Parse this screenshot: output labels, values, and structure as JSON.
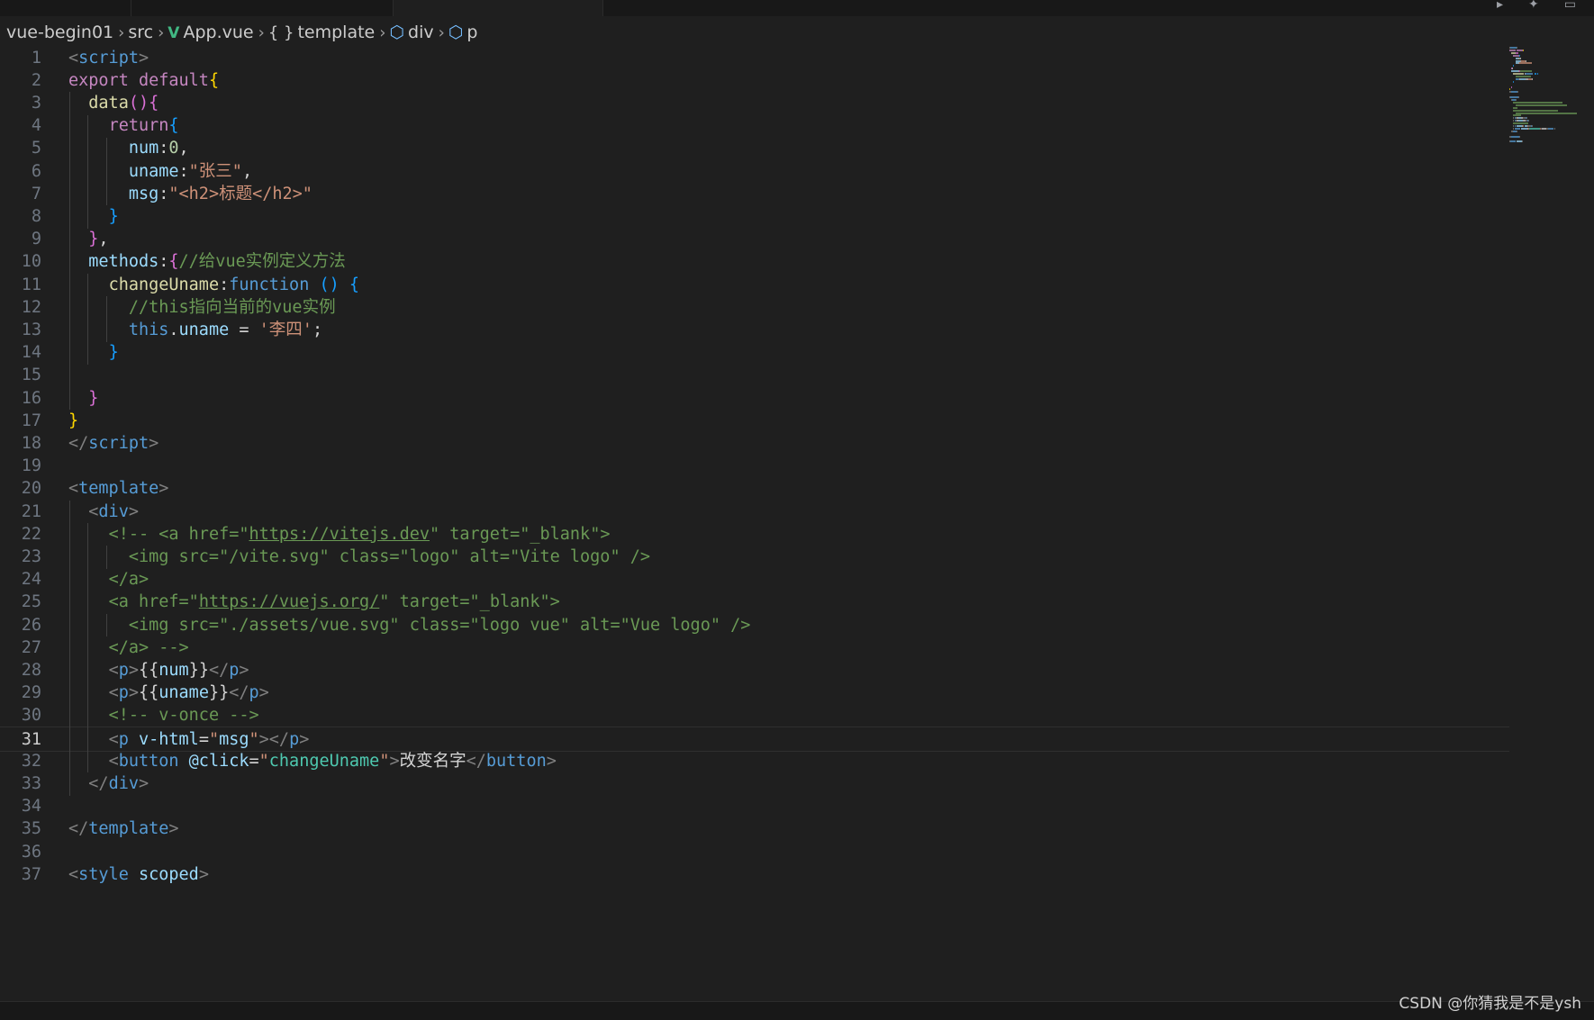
{
  "breadcrumb": {
    "items": [
      {
        "label": "vue-begin01",
        "icon": null
      },
      {
        "label": "src",
        "icon": null
      },
      {
        "label": "App.vue",
        "icon": "vue-icon",
        "glyph": "V"
      },
      {
        "label": "template",
        "icon": "braces-icon",
        "glyph": "{ }"
      },
      {
        "label": "div",
        "icon": "cube-icon",
        "glyph": "⬡"
      },
      {
        "label": "p",
        "icon": "cube-icon",
        "glyph": "⬡"
      }
    ],
    "separator": "›"
  },
  "editor": {
    "current_line": 31,
    "lines": [
      {
        "n": "1",
        "tokens": [
          [
            "t-p",
            "<"
          ],
          [
            "t-tag",
            "script"
          ],
          [
            "t-p",
            ">"
          ]
        ]
      },
      {
        "n": "2",
        "tokens": [
          [
            "t-ctl",
            "export"
          ],
          [
            "t-txt",
            " "
          ],
          [
            "t-ctl",
            "default"
          ],
          [
            "t-b1",
            "{"
          ]
        ]
      },
      {
        "n": "3",
        "tokens": [
          [
            "t-txt",
            "  "
          ],
          [
            "t-fn",
            "data"
          ],
          [
            "t-b2",
            "(){"
          ]
        ]
      },
      {
        "n": "4",
        "tokens": [
          [
            "t-txt",
            "    "
          ],
          [
            "t-ctl",
            "return"
          ],
          [
            "t-b3",
            "{"
          ]
        ]
      },
      {
        "n": "5",
        "tokens": [
          [
            "t-txt",
            "      "
          ],
          [
            "t-prop",
            "num"
          ],
          [
            "t-txt",
            ":"
          ],
          [
            "t-num",
            "0"
          ],
          [
            "t-txt",
            ","
          ]
        ]
      },
      {
        "n": "6",
        "tokens": [
          [
            "t-txt",
            "      "
          ],
          [
            "t-prop",
            "uname"
          ],
          [
            "t-txt",
            ":"
          ],
          [
            "t-str",
            "\"张三\""
          ],
          [
            "t-txt",
            ","
          ]
        ]
      },
      {
        "n": "7",
        "tokens": [
          [
            "t-txt",
            "      "
          ],
          [
            "t-prop",
            "msg"
          ],
          [
            "t-txt",
            ":"
          ],
          [
            "t-str",
            "\"<h2>标题</h2>\""
          ]
        ]
      },
      {
        "n": "8",
        "tokens": [
          [
            "t-txt",
            "    "
          ],
          [
            "t-b3",
            "}"
          ]
        ]
      },
      {
        "n": "9",
        "tokens": [
          [
            "t-txt",
            "  "
          ],
          [
            "t-b2",
            "}"
          ],
          [
            "t-txt",
            ","
          ]
        ]
      },
      {
        "n": "10",
        "tokens": [
          [
            "t-txt",
            "  "
          ],
          [
            "t-prop",
            "methods"
          ],
          [
            "t-txt",
            ":"
          ],
          [
            "t-b2",
            "{"
          ],
          [
            "t-cm",
            "//给vue实例定义方法"
          ]
        ]
      },
      {
        "n": "11",
        "tokens": [
          [
            "t-txt",
            "    "
          ],
          [
            "t-fn",
            "changeUname"
          ],
          [
            "t-txt",
            ":"
          ],
          [
            "t-kw",
            "function"
          ],
          [
            "t-txt",
            " "
          ],
          [
            "t-b3",
            "()"
          ],
          [
            "t-txt",
            " "
          ],
          [
            "t-b3",
            "{"
          ]
        ]
      },
      {
        "n": "12",
        "tokens": [
          [
            "t-txt",
            "      "
          ],
          [
            "t-cm",
            "//this指向当前的vue实例"
          ]
        ]
      },
      {
        "n": "13",
        "tokens": [
          [
            "t-txt",
            "      "
          ],
          [
            "t-kw",
            "this"
          ],
          [
            "t-txt",
            "."
          ],
          [
            "t-prop",
            "uname"
          ],
          [
            "t-txt",
            " = "
          ],
          [
            "t-str",
            "'李四'"
          ],
          [
            "t-txt",
            ";"
          ]
        ]
      },
      {
        "n": "14",
        "tokens": [
          [
            "t-txt",
            "    "
          ],
          [
            "t-b3",
            "}"
          ]
        ]
      },
      {
        "n": "15",
        "tokens": []
      },
      {
        "n": "16",
        "tokens": [
          [
            "t-txt",
            "  "
          ],
          [
            "t-b2",
            "}"
          ]
        ]
      },
      {
        "n": "17",
        "tokens": [
          [
            "t-b1",
            "}"
          ]
        ]
      },
      {
        "n": "18",
        "tokens": [
          [
            "t-p",
            "</"
          ],
          [
            "t-tag",
            "script"
          ],
          [
            "t-p",
            ">"
          ]
        ]
      },
      {
        "n": "19",
        "tokens": []
      },
      {
        "n": "20",
        "tokens": [
          [
            "t-p",
            "<"
          ],
          [
            "t-tag",
            "template"
          ],
          [
            "t-p",
            ">"
          ]
        ]
      },
      {
        "n": "21",
        "tokens": [
          [
            "t-txt",
            "  "
          ],
          [
            "t-p",
            "<"
          ],
          [
            "t-tag",
            "div"
          ],
          [
            "t-p",
            ">"
          ]
        ]
      },
      {
        "n": "22",
        "tokens": [
          [
            "t-txt",
            "    "
          ],
          [
            "t-cm",
            "<!-- <a href=\""
          ],
          [
            "t-cm t-url",
            "https://vitejs.dev"
          ],
          [
            "t-cm",
            "\" target=\"_blank\">"
          ]
        ]
      },
      {
        "n": "23",
        "tokens": [
          [
            "t-txt",
            "      "
          ],
          [
            "t-cm",
            "<img src=\"/vite.svg\" class=\"logo\" alt=\"Vite logo\" />"
          ]
        ]
      },
      {
        "n": "24",
        "tokens": [
          [
            "t-txt",
            "    "
          ],
          [
            "t-cm",
            "</a>"
          ]
        ]
      },
      {
        "n": "25",
        "tokens": [
          [
            "t-txt",
            "    "
          ],
          [
            "t-cm",
            "<a href=\""
          ],
          [
            "t-cm t-url",
            "https://vuejs.org/"
          ],
          [
            "t-cm",
            "\" target=\"_blank\">"
          ]
        ]
      },
      {
        "n": "26",
        "tokens": [
          [
            "t-txt",
            "      "
          ],
          [
            "t-cm",
            "<img src=\"./assets/vue.svg\" class=\"logo vue\" alt=\"Vue logo\" />"
          ]
        ]
      },
      {
        "n": "27",
        "tokens": [
          [
            "t-txt",
            "    "
          ],
          [
            "t-cm",
            "</a> -->"
          ]
        ]
      },
      {
        "n": "28",
        "tokens": [
          [
            "t-txt",
            "    "
          ],
          [
            "t-p",
            "<"
          ],
          [
            "t-tag",
            "p"
          ],
          [
            "t-p",
            ">"
          ],
          [
            "t-txt",
            "{{"
          ],
          [
            "t-prop",
            "num"
          ],
          [
            "t-txt",
            "}}"
          ],
          [
            "t-p",
            "</"
          ],
          [
            "t-tag",
            "p"
          ],
          [
            "t-p",
            ">"
          ]
        ]
      },
      {
        "n": "29",
        "tokens": [
          [
            "t-txt",
            "    "
          ],
          [
            "t-p",
            "<"
          ],
          [
            "t-tag",
            "p"
          ],
          [
            "t-p",
            ">"
          ],
          [
            "t-txt",
            "{{"
          ],
          [
            "t-prop",
            "uname"
          ],
          [
            "t-txt",
            "}}"
          ],
          [
            "t-p",
            "</"
          ],
          [
            "t-tag",
            "p"
          ],
          [
            "t-p",
            ">"
          ]
        ]
      },
      {
        "n": "30",
        "tokens": [
          [
            "t-txt",
            "    "
          ],
          [
            "t-cm",
            "<!-- v-once -->"
          ]
        ]
      },
      {
        "n": "31",
        "tokens": [
          [
            "t-txt",
            "    "
          ],
          [
            "t-p",
            "<"
          ],
          [
            "t-tag",
            "p"
          ],
          [
            "t-txt",
            " "
          ],
          [
            "t-attr",
            "v-html"
          ],
          [
            "t-txt",
            "="
          ],
          [
            "t-str",
            "\""
          ],
          [
            "t-prop",
            "msg"
          ],
          [
            "t-str",
            "\""
          ],
          [
            "t-p",
            "></"
          ],
          [
            "t-tag",
            "p"
          ],
          [
            "t-p",
            ">"
          ]
        ]
      },
      {
        "n": "32",
        "tokens": [
          [
            "t-txt",
            "    "
          ],
          [
            "t-p",
            "<"
          ],
          [
            "t-tag",
            "button"
          ],
          [
            "t-txt",
            " "
          ],
          [
            "t-attr",
            "@click"
          ],
          [
            "t-txt",
            "="
          ],
          [
            "t-str",
            "\""
          ],
          [
            "t-method",
            "changeUname"
          ],
          [
            "t-str",
            "\""
          ],
          [
            "t-p",
            ">"
          ],
          [
            "t-txt",
            "改变名字"
          ],
          [
            "t-p",
            "</"
          ],
          [
            "t-tag",
            "button"
          ],
          [
            "t-p",
            ">"
          ]
        ]
      },
      {
        "n": "33",
        "tokens": [
          [
            "t-txt",
            "  "
          ],
          [
            "t-p",
            "</"
          ],
          [
            "t-tag",
            "div"
          ],
          [
            "t-p",
            ">"
          ]
        ]
      },
      {
        "n": "34",
        "tokens": []
      },
      {
        "n": "35",
        "tokens": [
          [
            "t-p",
            "</"
          ],
          [
            "t-tag",
            "template"
          ],
          [
            "t-p",
            ">"
          ]
        ]
      },
      {
        "n": "36",
        "tokens": []
      },
      {
        "n": "37",
        "tokens": [
          [
            "t-p",
            "<"
          ],
          [
            "t-tag",
            "style"
          ],
          [
            "t-txt",
            " "
          ],
          [
            "t-attr",
            "scoped"
          ],
          [
            "t-p",
            ">"
          ]
        ]
      }
    ]
  },
  "watermark": "CSDN @你猜我是不是ysh"
}
